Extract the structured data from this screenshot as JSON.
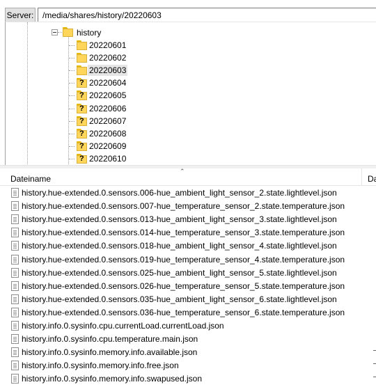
{
  "server": {
    "label": "Server:",
    "path": "/media/shares/history/20220603"
  },
  "tree": {
    "parent": {
      "label": "history"
    },
    "items": [
      {
        "label": "20220601",
        "icon": "folder-icon",
        "selected": false
      },
      {
        "label": "20220602",
        "icon": "folder-icon",
        "selected": false
      },
      {
        "label": "20220603",
        "icon": "folder-icon",
        "selected": true
      },
      {
        "label": "20220604",
        "icon": "unknown-folder-icon",
        "selected": false
      },
      {
        "label": "20220605",
        "icon": "unknown-folder-icon",
        "selected": false
      },
      {
        "label": "20220606",
        "icon": "unknown-folder-icon",
        "selected": false
      },
      {
        "label": "20220607",
        "icon": "unknown-folder-icon",
        "selected": false
      },
      {
        "label": "20220608",
        "icon": "unknown-folder-icon",
        "selected": false
      },
      {
        "label": "20220609",
        "icon": "unknown-folder-icon",
        "selected": false
      },
      {
        "label": "20220610",
        "icon": "unknown-folder-icon",
        "selected": false
      }
    ]
  },
  "list": {
    "columns": {
      "name": "Dateiname",
      "date": "Da"
    },
    "files": [
      "history.hue-extended.0.sensors.006-hue_ambient_light_sensor_2.state.lightlevel.json",
      "history.hue-extended.0.sensors.007-hue_temperature_sensor_2.state.temperature.json",
      "history.hue-extended.0.sensors.013-hue_ambient_light_sensor_3.state.lightlevel.json",
      "history.hue-extended.0.sensors.014-hue_temperature_sensor_3.state.temperature.json",
      "history.hue-extended.0.sensors.018-hue_ambient_light_sensor_4.state.lightlevel.json",
      "history.hue-extended.0.sensors.019-hue_temperature_sensor_4.state.temperature.json",
      "history.hue-extended.0.sensors.025-hue_ambient_light_sensor_5.state.lightlevel.json",
      "history.hue-extended.0.sensors.026-hue_temperature_sensor_5.state.temperature.json",
      "history.hue-extended.0.sensors.035-hue_ambient_light_sensor_6.state.lightlevel.json",
      "history.hue-extended.0.sensors.036-hue_temperature_sensor_6.state.temperature.json",
      "history.info.0.sysinfo.cpu.currentLoad.currentLoad.json",
      "history.info.0.sysinfo.cpu.temperature.main.json",
      "history.info.0.sysinfo.memory.info.available.json",
      "history.info.0.sysinfo.memory.info.free.json",
      "history.info.0.sysinfo.memory.info.swapused.json"
    ]
  }
}
